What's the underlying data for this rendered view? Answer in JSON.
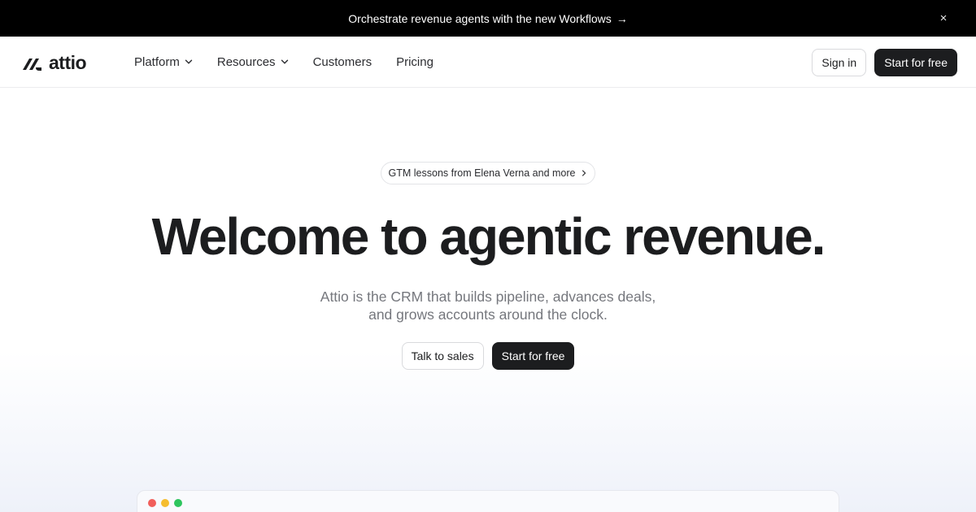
{
  "announcement": {
    "text": "Orchestrate revenue agents with the new Workflows",
    "arrow": "→",
    "close": "×"
  },
  "nav": {
    "logo_text": "attio",
    "items": [
      {
        "label": "Platform",
        "has_dropdown": true
      },
      {
        "label": "Resources",
        "has_dropdown": true
      },
      {
        "label": "Customers",
        "has_dropdown": false
      },
      {
        "label": "Pricing",
        "has_dropdown": false
      }
    ],
    "sign_in": "Sign in",
    "start": "Start for free"
  },
  "hero": {
    "pill_text": "GTM lessons from Elena Verna and more",
    "headline": "Welcome to agentic revenue.",
    "subtitle": "Attio is the CRM that builds pipeline, advances deals, and grows accounts around the clock.",
    "cta_secondary": "Talk to sales",
    "cta_primary": "Start for free"
  },
  "window": {
    "dot_colors": [
      "#f15f5b",
      "#f5bd2f",
      "#2ec55e"
    ]
  },
  "colors": {
    "dark": "#1c1d1f",
    "muted_text": "#75777d",
    "announcement_bg": "#000000"
  }
}
